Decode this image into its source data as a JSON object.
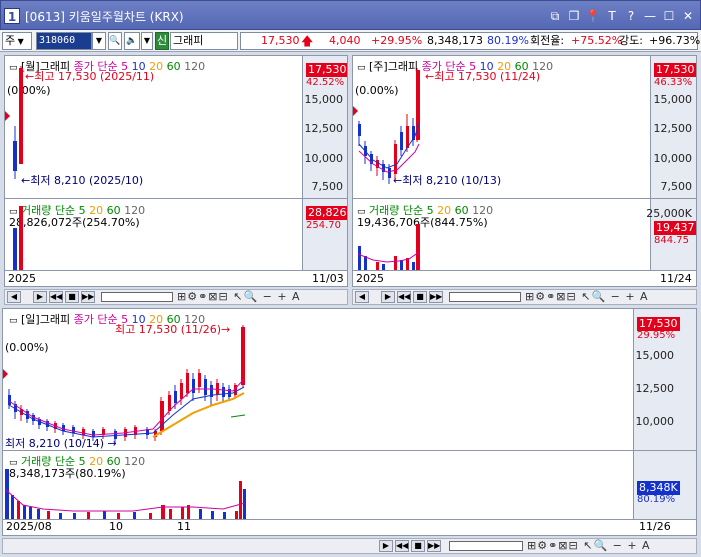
{
  "window": {
    "number": "1",
    "title": "[0613] 키움일주월차트 (KRX)",
    "controls": [
      "⧉",
      "❐",
      "📌",
      "T",
      "?",
      "—",
      "☐",
      "✕"
    ]
  },
  "toolbar": {
    "market": "주",
    "code": "318060",
    "shin": "신",
    "name": "그래피",
    "price": "17,530",
    "change": "4,040",
    "change_pct": "+29.95%",
    "volume": "8,348,173",
    "vol_ratio": "80.19%",
    "turnover_label": "회전율:",
    "turnover": "+75.52%",
    "strength_label": "강도:",
    "strength": "+96.73%"
  },
  "monthly": {
    "title": "[월]그래피",
    "ma_label": "종가 단순 5",
    "ma": [
      "10",
      "20",
      "60",
      "120"
    ],
    "price_badge": "17,530",
    "pct": "42.52%",
    "yticks": [
      "15,000",
      "12,500",
      "10,000",
      "7,500"
    ],
    "high_label": "최고 17,530 (2025/11)",
    "low_label": "최저 8,210 (2025/10)",
    "zero_label": "(0.00%)",
    "vol_title": "거래량 단순 5",
    "vol_ma": [
      "20",
      "60",
      "120"
    ],
    "vol_value": "28,826,072주(254.70%)",
    "vol_badge": "28,826",
    "vol_pct": "254.70",
    "date_left": "2025",
    "date_right": "11/03"
  },
  "weekly": {
    "title": "[주]그래피",
    "ma_label": "종가 단순 5",
    "ma": [
      "10",
      "20",
      "60",
      "120"
    ],
    "price_badge": "17,530",
    "pct": "46.33%",
    "yticks": [
      "15,000",
      "12,500",
      "10,000",
      "7,500"
    ],
    "high_label": "최고 17,530 (11/24)",
    "low_label": "최저 8,210 (10/13)",
    "zero_label": "(0.00%)",
    "vol_title": "거래량 단순 5",
    "vol_ma": [
      "20",
      "60",
      "120"
    ],
    "vol_value": "19,436,706주(844.75%)",
    "vol_badge": "19,437",
    "vol_pct": "844.75",
    "vol_top": "25,000K",
    "date_left": "2025",
    "date_right": "11/24"
  },
  "daily": {
    "title": "[일]그래피",
    "ma_label": "종가 단순 5",
    "ma": [
      "10",
      "20",
      "60",
      "120"
    ],
    "price_badge": "17,530",
    "pct": "29.95%",
    "yticks": [
      "15,000",
      "12,500",
      "10,000"
    ],
    "high_label": "최고 17,530 (11/26)",
    "low_label": "최저 8,210 (10/14)",
    "zero_label": "(0.00%)",
    "vol_title": "거래량 단순 5",
    "vol_ma": [
      "20",
      "60",
      "120"
    ],
    "vol_value": "8,348,173주(80.19%)",
    "vol_badge": "8,348K",
    "vol_pct": "80.19%",
    "dates": [
      "2025/08",
      "10",
      "11"
    ],
    "date_right": "11/26"
  },
  "colors": {
    "up": "#e3001b",
    "down": "#1431cc",
    "ma5": "#e3001b",
    "ma10": "#1431cc",
    "ma20": "#f0a000",
    "ma60": "#008a00",
    "ma120": "#666666"
  }
}
